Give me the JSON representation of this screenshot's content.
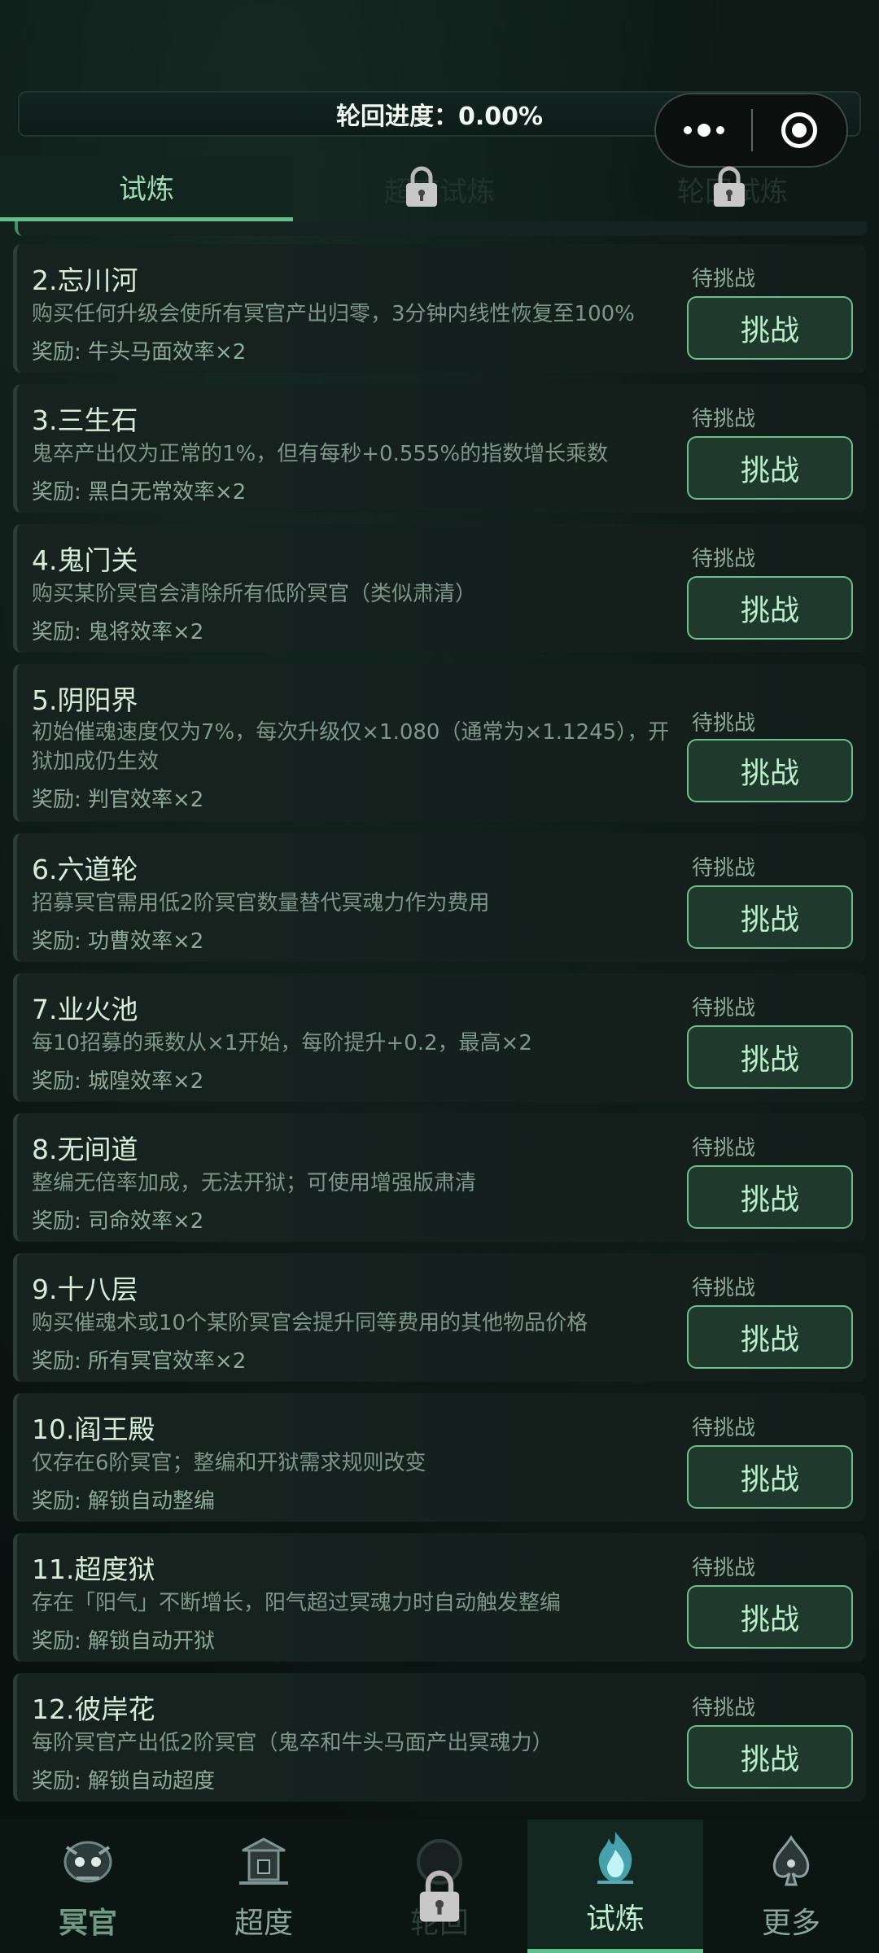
{
  "header": {
    "progress_text": "轮回进度：0.00%",
    "progress_fraction": 0.0
  },
  "tabs": [
    {
      "label": "试炼",
      "active": true,
      "locked": false
    },
    {
      "label": "超度试炼",
      "active": false,
      "locked": true
    },
    {
      "label": "轮回试炼",
      "active": false,
      "locked": true
    }
  ],
  "trials": [
    {
      "title": "2.忘川河",
      "desc": "购买任何升级会使所有冥官产出归零，3分钟内线性恢复至100%",
      "reward": "奖励: 牛头马面效率×2",
      "status": "待挑战",
      "button": "挑战"
    },
    {
      "title": "3.三生石",
      "desc": "鬼卒产出仅为正常的1%，但有每秒+0.555%的指数增长乘数",
      "reward": "奖励: 黑白无常效率×2",
      "status": "待挑战",
      "button": "挑战"
    },
    {
      "title": "4.鬼门关",
      "desc": "购买某阶冥官会清除所有低阶冥官（类似肃清）",
      "reward": "奖励: 鬼将效率×2",
      "status": "待挑战",
      "button": "挑战"
    },
    {
      "title": "5.阴阳界",
      "desc": "初始催魂速度仅为7%，每次升级仅×1.080（通常为×1.1245），开狱加成仍生效",
      "reward": "奖励: 判官效率×2",
      "status": "待挑战",
      "button": "挑战"
    },
    {
      "title": "6.六道轮",
      "desc": "招募冥官需用低2阶冥官数量替代冥魂力作为费用",
      "reward": "奖励: 功曹效率×2",
      "status": "待挑战",
      "button": "挑战"
    },
    {
      "title": "7.业火池",
      "desc": "每10招募的乘数从×1开始，每阶提升+0.2，最高×2",
      "reward": "奖励: 城隍效率×2",
      "status": "待挑战",
      "button": "挑战"
    },
    {
      "title": "8.无间道",
      "desc": "整编无倍率加成，无法开狱；可使用增强版肃清",
      "reward": "奖励: 司命效率×2",
      "status": "待挑战",
      "button": "挑战"
    },
    {
      "title": "9.十八层",
      "desc": "购买催魂术或10个某阶冥官会提升同等费用的其他物品价格",
      "reward": "奖励: 所有冥官效率×2",
      "status": "待挑战",
      "button": "挑战"
    },
    {
      "title": "10.阎王殿",
      "desc": "仅存在6阶冥官；整编和开狱需求规则改变",
      "reward": "奖励: 解锁自动整编",
      "status": "待挑战",
      "button": "挑战"
    },
    {
      "title": "11.超度狱",
      "desc": "存在「阳气」不断增长，阳气超过冥魂力时自动触发整编",
      "reward": "奖励: 解锁自动开狱",
      "status": "待挑战",
      "button": "挑战"
    },
    {
      "title": "12.彼岸花",
      "desc": "每阶冥官产出低2阶冥官（鬼卒和牛头马面产出冥魂力）",
      "reward": "奖励: 解锁自动超度",
      "status": "待挑战",
      "button": "挑战"
    }
  ],
  "bottom_nav": [
    {
      "label": "冥官",
      "icon": "skull-icon",
      "active": false,
      "locked": false
    },
    {
      "label": "超度",
      "icon": "shrine-icon",
      "active": false,
      "locked": false
    },
    {
      "label": "轮回",
      "icon": "wheel-icon",
      "active": false,
      "locked": true
    },
    {
      "label": "试炼",
      "icon": "flame-icon",
      "active": true,
      "locked": false
    },
    {
      "label": "更多",
      "icon": "spade-icon",
      "active": false,
      "locked": false
    }
  ],
  "colors": {
    "accent": "#5fc08c",
    "button_bg": "#1f3a2c",
    "card_bg": "#16231f"
  }
}
